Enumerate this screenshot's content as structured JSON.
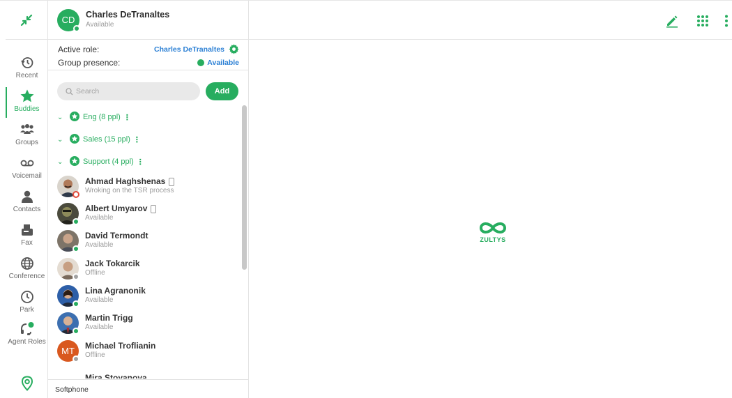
{
  "colors": {
    "accent": "#27ad5f",
    "link": "#2a7fd4",
    "status_available": "#27ad5f",
    "status_offline": "#a2a2a2",
    "status_busy": "#e24b3b"
  },
  "nav": {
    "collapse_icon": "collapse-arrows-icon",
    "items": [
      {
        "label": "Recent",
        "icon": "history-icon"
      },
      {
        "label": "Buddies",
        "icon": "star-icon",
        "active": true
      },
      {
        "label": "Groups",
        "icon": "people-icon"
      },
      {
        "label": "Voicemail",
        "icon": "voicemail-icon"
      },
      {
        "label": "Contacts",
        "icon": "person-icon"
      },
      {
        "label": "Fax",
        "icon": "fax-icon"
      },
      {
        "label": "Conference",
        "icon": "globe-icon"
      },
      {
        "label": "Park",
        "icon": "clock-icon"
      },
      {
        "label": "Agent Roles",
        "icon": "headset-icon"
      }
    ],
    "bottom_icon": "location-pin-icon"
  },
  "user": {
    "initials": "CD",
    "name": "Charles DeTranaltes",
    "status": "Available"
  },
  "role": {
    "active_role_label": "Active role:",
    "active_role_value": "Charles DeTranaltes",
    "group_presence_label": "Group presence:",
    "group_presence_value": "Available"
  },
  "search": {
    "placeholder": "Search",
    "add_label": "Add"
  },
  "groups": [
    {
      "label": "Eng (8 ppl)"
    },
    {
      "label": "Sales (15 ppl)"
    },
    {
      "label": "Support (4 ppl)"
    }
  ],
  "buddies": [
    {
      "name": "Ahmad Haghshenas",
      "status": "Wroking on the TSR process",
      "presence": "busy",
      "phone": true
    },
    {
      "name": "Albert Umyarov",
      "status": "Available",
      "presence": "available",
      "phone": true
    },
    {
      "name": "David Termondt",
      "status": "Available",
      "presence": "available",
      "phone": false
    },
    {
      "name": "Jack Tokarcik",
      "status": "Offline",
      "presence": "offline",
      "phone": false
    },
    {
      "name": "Lina Agranonik",
      "status": "Available",
      "presence": "available",
      "phone": false
    },
    {
      "name": "Martin Trigg",
      "status": "Available",
      "presence": "available",
      "phone": false
    },
    {
      "name": "Michael Troflianin",
      "status": "Offline",
      "presence": "offline",
      "phone": false,
      "initials": "MT"
    },
    {
      "name": "Mira Stoyanova",
      "status": "",
      "presence": "",
      "phone": false
    }
  ],
  "footer": {
    "softphone": "Softphone"
  },
  "topbar": {
    "icons": [
      "edit-pencil-icon",
      "dialpad-grid-icon",
      "more-vertical-icon"
    ]
  },
  "brand": {
    "logo_text": "ZULTYS"
  }
}
